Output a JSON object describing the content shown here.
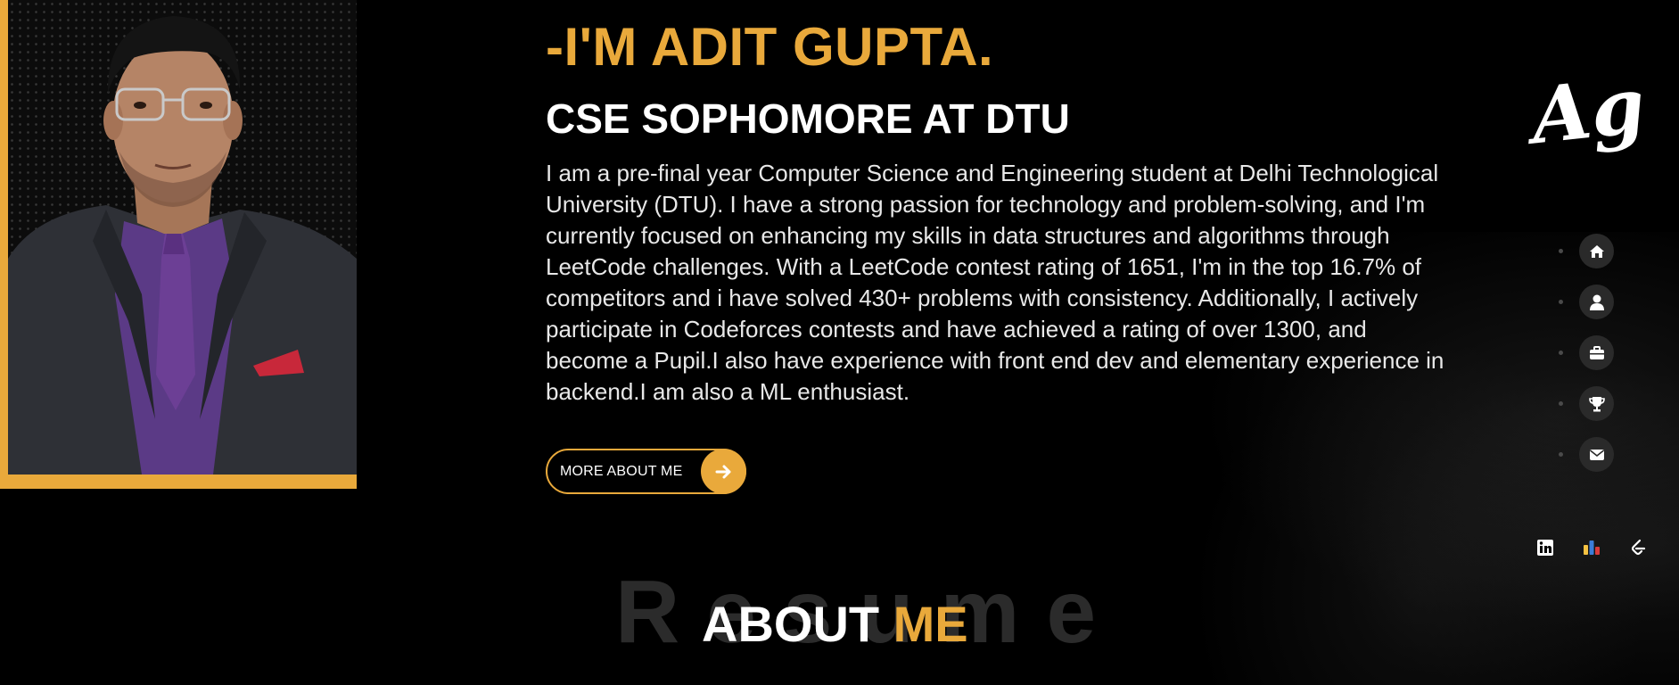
{
  "hero": {
    "title": "-I'M ADIT GUPTA.",
    "subtitle": "CSE SOPHOMORE AT DTU",
    "description": "I am a pre-final year Computer Science and Engineering student at Delhi Technological University (DTU). I have a strong passion for technology and problem-solving, and I'm currently focused on enhancing my skills in data structures and algorithms through LeetCode challenges. With a LeetCode contest rating of 1651, I'm in the top 16.7% of competitors and i have solved 430+ problems with consistency. Additionally, I actively participate in Codeforces contests and have achieved a rating of over 1300, and become a Pupil.I also have experience with front end dev and elementary experience in backend.I am also a ML enthusiast.",
    "button_label": "MORE ABOUT ME",
    "button_icon": "arrow-right-icon"
  },
  "logo": {
    "text": "Ag"
  },
  "nav": {
    "items": [
      {
        "icon": "home-icon"
      },
      {
        "icon": "user-icon"
      },
      {
        "icon": "briefcase-icon"
      },
      {
        "icon": "trophy-icon"
      },
      {
        "icon": "envelope-icon"
      }
    ]
  },
  "social": {
    "items": [
      {
        "icon": "linkedin-icon"
      },
      {
        "icon": "codeforces-icon"
      },
      {
        "icon": "leetcode-icon"
      }
    ]
  },
  "about": {
    "background_word": "Resume",
    "title_word1": "ABOUT",
    "title_word2": "ME"
  },
  "colors": {
    "accent": "#e9a93b",
    "background": "#000000",
    "nav_circle": "#2a2a2a",
    "faded_text": "#2b2b2b"
  }
}
